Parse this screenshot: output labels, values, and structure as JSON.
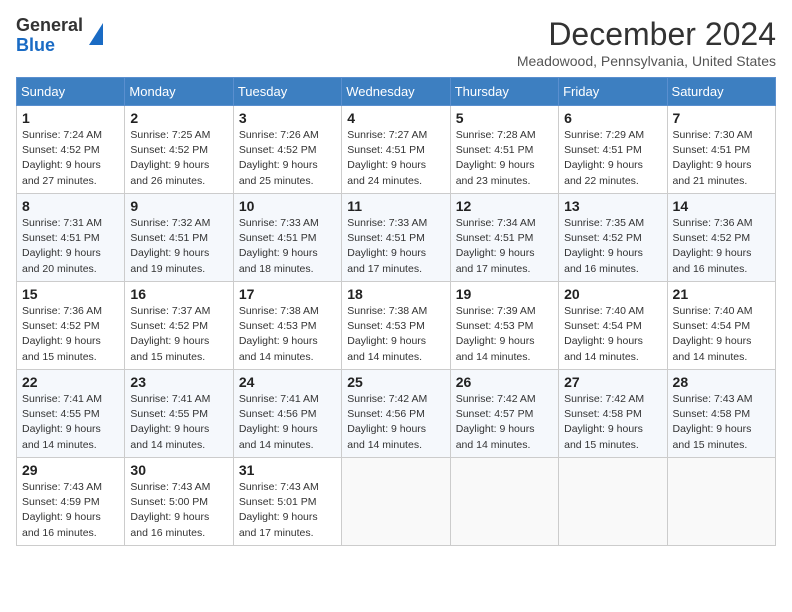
{
  "logo": {
    "general": "General",
    "blue": "Blue"
  },
  "title": "December 2024",
  "location": "Meadowood, Pennsylvania, United States",
  "days_of_week": [
    "Sunday",
    "Monday",
    "Tuesday",
    "Wednesday",
    "Thursday",
    "Friday",
    "Saturday"
  ],
  "weeks": [
    [
      {
        "day": "1",
        "sunrise": "7:24 AM",
        "sunset": "4:52 PM",
        "daylight": "9 hours and 27 minutes."
      },
      {
        "day": "2",
        "sunrise": "7:25 AM",
        "sunset": "4:52 PM",
        "daylight": "9 hours and 26 minutes."
      },
      {
        "day": "3",
        "sunrise": "7:26 AM",
        "sunset": "4:52 PM",
        "daylight": "9 hours and 25 minutes."
      },
      {
        "day": "4",
        "sunrise": "7:27 AM",
        "sunset": "4:51 PM",
        "daylight": "9 hours and 24 minutes."
      },
      {
        "day": "5",
        "sunrise": "7:28 AM",
        "sunset": "4:51 PM",
        "daylight": "9 hours and 23 minutes."
      },
      {
        "day": "6",
        "sunrise": "7:29 AM",
        "sunset": "4:51 PM",
        "daylight": "9 hours and 22 minutes."
      },
      {
        "day": "7",
        "sunrise": "7:30 AM",
        "sunset": "4:51 PM",
        "daylight": "9 hours and 21 minutes."
      }
    ],
    [
      {
        "day": "8",
        "sunrise": "7:31 AM",
        "sunset": "4:51 PM",
        "daylight": "9 hours and 20 minutes."
      },
      {
        "day": "9",
        "sunrise": "7:32 AM",
        "sunset": "4:51 PM",
        "daylight": "9 hours and 19 minutes."
      },
      {
        "day": "10",
        "sunrise": "7:33 AM",
        "sunset": "4:51 PM",
        "daylight": "9 hours and 18 minutes."
      },
      {
        "day": "11",
        "sunrise": "7:33 AM",
        "sunset": "4:51 PM",
        "daylight": "9 hours and 17 minutes."
      },
      {
        "day": "12",
        "sunrise": "7:34 AM",
        "sunset": "4:51 PM",
        "daylight": "9 hours and 17 minutes."
      },
      {
        "day": "13",
        "sunrise": "7:35 AM",
        "sunset": "4:52 PM",
        "daylight": "9 hours and 16 minutes."
      },
      {
        "day": "14",
        "sunrise": "7:36 AM",
        "sunset": "4:52 PM",
        "daylight": "9 hours and 16 minutes."
      }
    ],
    [
      {
        "day": "15",
        "sunrise": "7:36 AM",
        "sunset": "4:52 PM",
        "daylight": "9 hours and 15 minutes."
      },
      {
        "day": "16",
        "sunrise": "7:37 AM",
        "sunset": "4:52 PM",
        "daylight": "9 hours and 15 minutes."
      },
      {
        "day": "17",
        "sunrise": "7:38 AM",
        "sunset": "4:53 PM",
        "daylight": "9 hours and 14 minutes."
      },
      {
        "day": "18",
        "sunrise": "7:38 AM",
        "sunset": "4:53 PM",
        "daylight": "9 hours and 14 minutes."
      },
      {
        "day": "19",
        "sunrise": "7:39 AM",
        "sunset": "4:53 PM",
        "daylight": "9 hours and 14 minutes."
      },
      {
        "day": "20",
        "sunrise": "7:40 AM",
        "sunset": "4:54 PM",
        "daylight": "9 hours and 14 minutes."
      },
      {
        "day": "21",
        "sunrise": "7:40 AM",
        "sunset": "4:54 PM",
        "daylight": "9 hours and 14 minutes."
      }
    ],
    [
      {
        "day": "22",
        "sunrise": "7:41 AM",
        "sunset": "4:55 PM",
        "daylight": "9 hours and 14 minutes."
      },
      {
        "day": "23",
        "sunrise": "7:41 AM",
        "sunset": "4:55 PM",
        "daylight": "9 hours and 14 minutes."
      },
      {
        "day": "24",
        "sunrise": "7:41 AM",
        "sunset": "4:56 PM",
        "daylight": "9 hours and 14 minutes."
      },
      {
        "day": "25",
        "sunrise": "7:42 AM",
        "sunset": "4:56 PM",
        "daylight": "9 hours and 14 minutes."
      },
      {
        "day": "26",
        "sunrise": "7:42 AM",
        "sunset": "4:57 PM",
        "daylight": "9 hours and 14 minutes."
      },
      {
        "day": "27",
        "sunrise": "7:42 AM",
        "sunset": "4:58 PM",
        "daylight": "9 hours and 15 minutes."
      },
      {
        "day": "28",
        "sunrise": "7:43 AM",
        "sunset": "4:58 PM",
        "daylight": "9 hours and 15 minutes."
      }
    ],
    [
      {
        "day": "29",
        "sunrise": "7:43 AM",
        "sunset": "4:59 PM",
        "daylight": "9 hours and 16 minutes."
      },
      {
        "day": "30",
        "sunrise": "7:43 AM",
        "sunset": "5:00 PM",
        "daylight": "9 hours and 16 minutes."
      },
      {
        "day": "31",
        "sunrise": "7:43 AM",
        "sunset": "5:01 PM",
        "daylight": "9 hours and 17 minutes."
      },
      null,
      null,
      null,
      null
    ]
  ],
  "labels": {
    "sunrise": "Sunrise:",
    "sunset": "Sunset:",
    "daylight": "Daylight:"
  }
}
